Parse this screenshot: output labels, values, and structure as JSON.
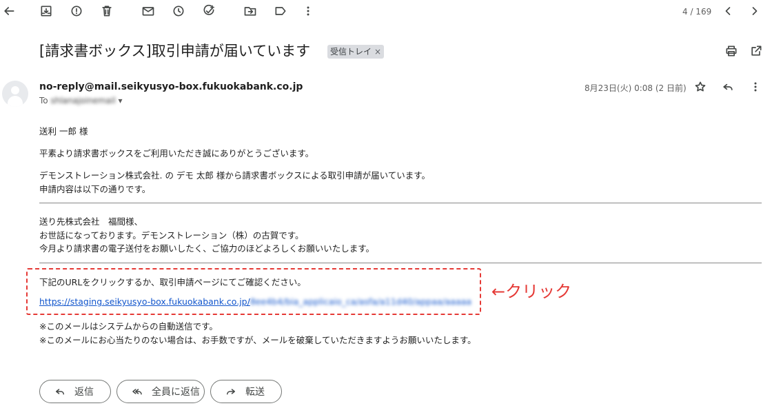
{
  "toolbar": {
    "icons": [
      "back-arrow-icon",
      "archive-icon",
      "report-spam-icon",
      "delete-icon",
      "mark-unread-icon",
      "snooze-icon",
      "add-task-icon",
      "move-to-icon",
      "label-icon",
      "more-vert-icon"
    ],
    "pager": "4 / 169"
  },
  "subject": "[請求書ボックス]取引申請が届いています",
  "label_chip": {
    "text": "受信トレイ",
    "close": "×"
  },
  "message": {
    "sender": "no-reply@mail.seikyusyo-box.fukuokabank.co.jp",
    "to_prefix": "To",
    "to_redacted": "shlanajoinemail",
    "date": "8月23日(火) 0:08 (2 日前)"
  },
  "body": {
    "greeting": "送利 一郎 様",
    "line1": "平素より請求書ボックスをご利用いただき誠にありがとうございます。",
    "line2": "デモンストレーション株式会社. の デモ 太郎 様から請求書ボックスによる取引申請が届いています。",
    "line3": "申請内容は以下の通りです。",
    "quote1": "送り先株式会社　福間様、",
    "quote2": "お世話になっております。デモンストレーション（株）の古賀です。",
    "quote3": "今月より請求書の電子送付をお願いしたく、ご協力のほどよろしくお願いいたします。",
    "instruction": "下記のURLをクリックするか、取引申請ページにてご確認ください。",
    "link_visible": "https://staging.seikyusyo-box.fukuokabank.co.jp/",
    "link_redacted": "8ee4b4/bia_applicaio_ca/asfa/a11d40/appaa/aaaaa",
    "note1": "※このメールはシステムからの自動送信です。",
    "note2": "※このメールにお心当たりのない場合は、お手数ですが、メールを破棄していただきますようお願いいたします。"
  },
  "annotation": "←クリック",
  "actions": {
    "reply": "返信",
    "reply_all": "全員に返信",
    "forward": "転送"
  },
  "colors": {
    "link": "#1155cc",
    "annotation": "#e53935"
  }
}
